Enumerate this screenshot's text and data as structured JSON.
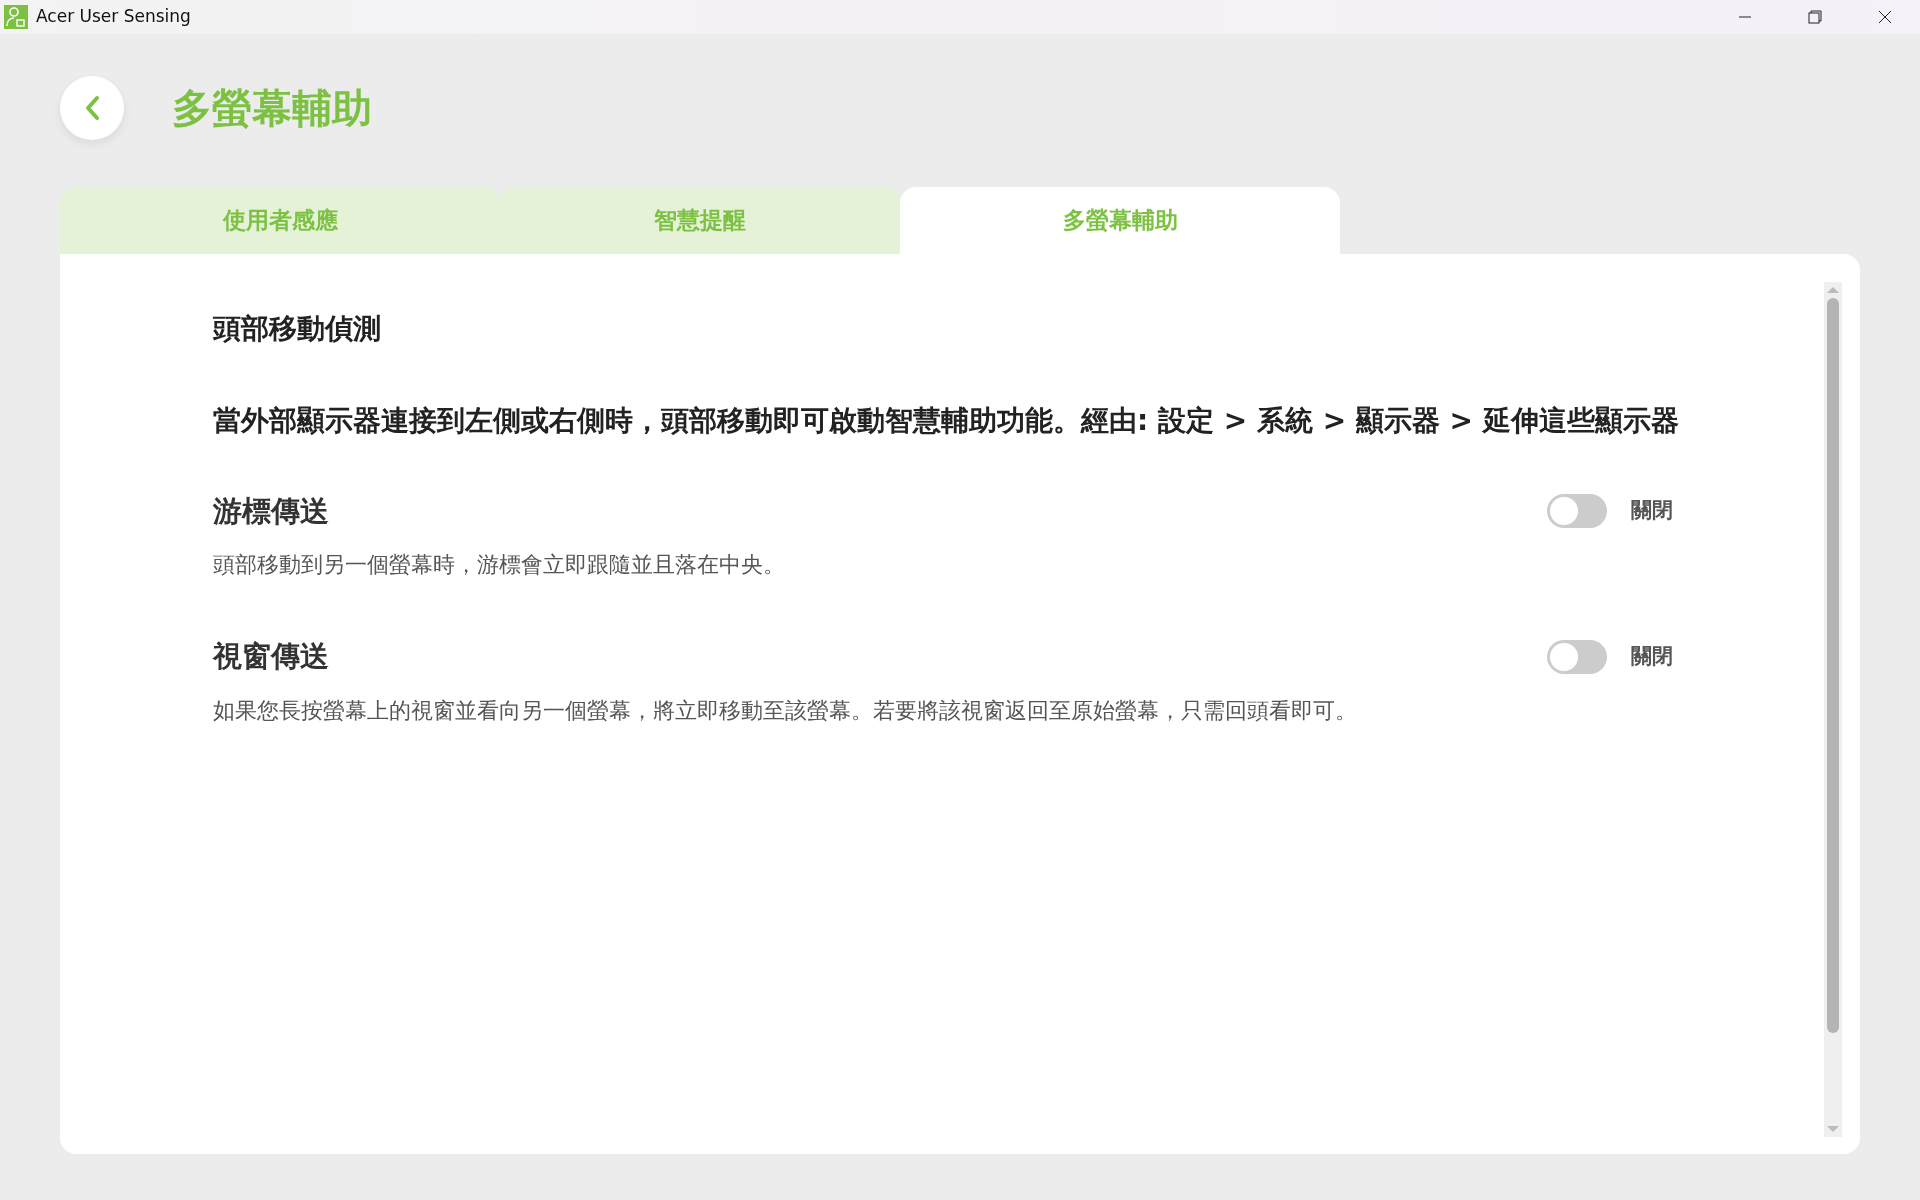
{
  "window": {
    "title": "Acer User Sensing"
  },
  "page": {
    "title": "多螢幕輔助"
  },
  "tabs": [
    {
      "label": "使用者感應",
      "selected": false
    },
    {
      "label": "智慧提醒",
      "selected": false
    },
    {
      "label": "多螢幕輔助",
      "selected": true
    }
  ],
  "section": {
    "heading": "頭部移動偵測",
    "description": "當外部顯示器連接到左側或右側時，頭部移動即可啟動智慧輔助功能。經由: 設定 > 系統 > 顯示器 > 延伸這些顯示器"
  },
  "settings": [
    {
      "title": "游標傳送",
      "description": "頭部移動到另一個螢幕時，游標會立即跟隨並且落在中央。",
      "on": false,
      "state_label": "關閉"
    },
    {
      "title": "視窗傳送",
      "description": "如果您長按螢幕上的視窗並看向另一個螢幕，將立即移動至該螢幕。若要將該視窗返回至原始螢幕，只需回頭看即可。",
      "on": false,
      "state_label": "關閉"
    }
  ]
}
